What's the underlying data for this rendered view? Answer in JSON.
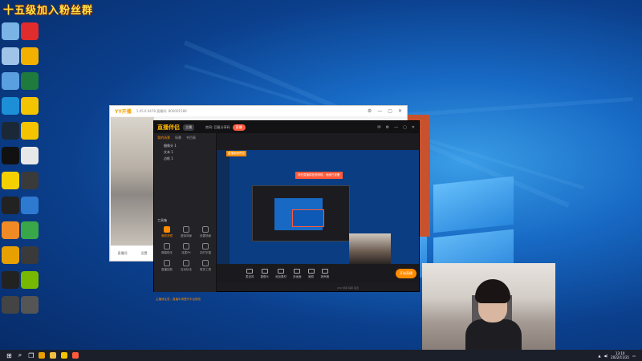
{
  "banner": "十五级加入粉丝群",
  "desktop_icons": [
    {
      "name": "this-pc-icon",
      "color": "#7ab3e6"
    },
    {
      "name": "netease-music-icon",
      "color": "#e02c2c"
    },
    {
      "name": "recycle-bin-icon",
      "color": "#9fc4e8"
    },
    {
      "name": "game-app-icon",
      "color": "#f3b000"
    },
    {
      "name": "control-panel-icon",
      "color": "#5aa0e0"
    },
    {
      "name": "excel-icon",
      "color": "#1f7a3d"
    },
    {
      "name": "edge-icon",
      "color": "#1d8fd6"
    },
    {
      "name": "yy-icon",
      "color": "#f5c400"
    },
    {
      "name": "steam-icon",
      "color": "#1b2838"
    },
    {
      "name": "yy2-icon",
      "color": "#f5c400"
    },
    {
      "name": "qq-icon",
      "color": "#111111"
    },
    {
      "name": "file-icon",
      "color": "#e8e8e8"
    },
    {
      "name": "qq-music-icon",
      "color": "#f5d000"
    },
    {
      "name": "game2-icon",
      "color": "#3a3a3a"
    },
    {
      "name": "app-circle-icon",
      "color": "#222222"
    },
    {
      "name": "network-icon",
      "color": "#2e7ad0"
    },
    {
      "name": "cat-icon",
      "color": "#f08a24"
    },
    {
      "name": "green-icon",
      "color": "#3aa64a"
    },
    {
      "name": "chrome-icon",
      "color": "#e8a000"
    },
    {
      "name": "nvidia-icon",
      "color": "#3a3a3a"
    },
    {
      "name": "obs-icon",
      "color": "#222222"
    },
    {
      "name": "geforce-icon",
      "color": "#76b900"
    },
    {
      "name": "game3-icon",
      "color": "#444444"
    },
    {
      "name": "game4-icon",
      "color": "#555555"
    }
  ],
  "yy": {
    "brand": "YY开播",
    "version": "1.45.0.0478  直播间: 800001589",
    "controls": [
      "⚙",
      "—",
      "▢",
      "✕"
    ],
    "bottom_labels": [
      "直播间",
      "设置"
    ]
  },
  "app": {
    "logo": "直播伴侣",
    "tag": "主播",
    "room_label": "房间: 回复分享码",
    "live_pill": "直播",
    "tabs": [
      "我的场景",
      "场景",
      "节目表"
    ],
    "scenes": [
      "摄像头 1",
      "文本 1",
      "边框 1"
    ],
    "tools_heading": "工具箱",
    "tools": [
      "美颜滤镜",
      "虚拟背景",
      "设置场景",
      "弹幕助手",
      "连麦PK",
      "实时字幕",
      "直播回放",
      "互动玩法",
      "更多工具"
    ],
    "orange_label": "直播画面预览",
    "red_tip": "请在直播前检查网络，画面已准备",
    "toolbar": [
      "麦克风",
      "摄像头",
      "添加素材",
      "多画面",
      "美颜",
      "扬声器"
    ],
    "go_live": "开始直播",
    "notice": "主播请注意，直播中请遵守平台规范",
    "status": "CPU  帧率  码率  延迟"
  },
  "taskbar": {
    "time": "13:10",
    "date": "2022/11/21"
  }
}
